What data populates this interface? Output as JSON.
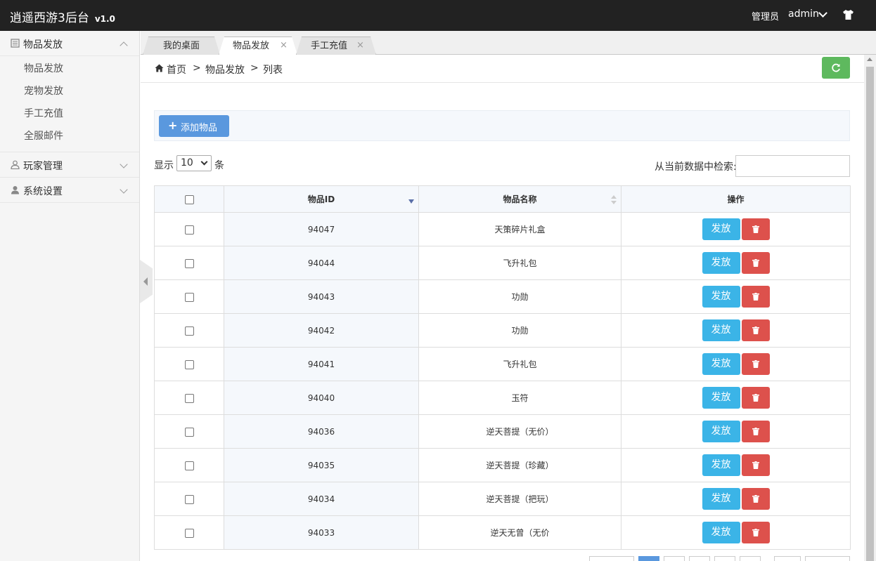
{
  "header": {
    "title": "逍遥西游3后台",
    "version": "v1.0",
    "role_label": "管理员",
    "username": "admin"
  },
  "sidebar": {
    "groups": [
      {
        "label": "物品发放",
        "icon": "book-icon",
        "expanded": true,
        "items": [
          "物品发放",
          "宠物发放",
          "手工充值",
          "全服邮件"
        ]
      },
      {
        "label": "玩家管理",
        "icon": "user-outline-icon",
        "expanded": false
      },
      {
        "label": "系统设置",
        "icon": "user-icon",
        "expanded": false
      }
    ]
  },
  "tabs": [
    {
      "label": "我的桌面",
      "active": false,
      "closable": false
    },
    {
      "label": "物品发放",
      "active": true,
      "closable": true
    },
    {
      "label": "手工充值",
      "active": false,
      "closable": true
    }
  ],
  "tab_close_glyph": "×",
  "breadcrumb": {
    "home": "首页",
    "sep": ">",
    "section": "物品发放",
    "page": "列表"
  },
  "toolbar": {
    "add_label": "添加物品",
    "add_icon": "+"
  },
  "length_control": {
    "prefix": "显示",
    "value": "10",
    "suffix": "条"
  },
  "search": {
    "label": "从当前数据中检索:",
    "value": ""
  },
  "table": {
    "columns": [
      "物品ID",
      "物品名称",
      "操作"
    ],
    "sorted_column": "物品ID",
    "sort_direction": "desc",
    "issue_label": "发放",
    "rows": [
      {
        "id": "94047",
        "name": "天策碎片礼盒"
      },
      {
        "id": "94044",
        "name": "飞升礼包"
      },
      {
        "id": "94043",
        "name": "功勋"
      },
      {
        "id": "94042",
        "name": "功勋"
      },
      {
        "id": "94041",
        "name": "飞升礼包"
      },
      {
        "id": "94040",
        "name": "玉符"
      },
      {
        "id": "94036",
        "name": "逆天菩提（无价）"
      },
      {
        "id": "94035",
        "name": "逆天菩提（珍藏）"
      },
      {
        "id": "94034",
        "name": "逆天菩提（把玩）"
      },
      {
        "id": "94033",
        "name": "逆天无曾（无价"
      }
    ]
  },
  "colors": {
    "header_bg": "#222222",
    "primary": "#5a98de",
    "success": "#5eb95e",
    "info": "#3bb4e7",
    "danger": "#dd514c"
  }
}
